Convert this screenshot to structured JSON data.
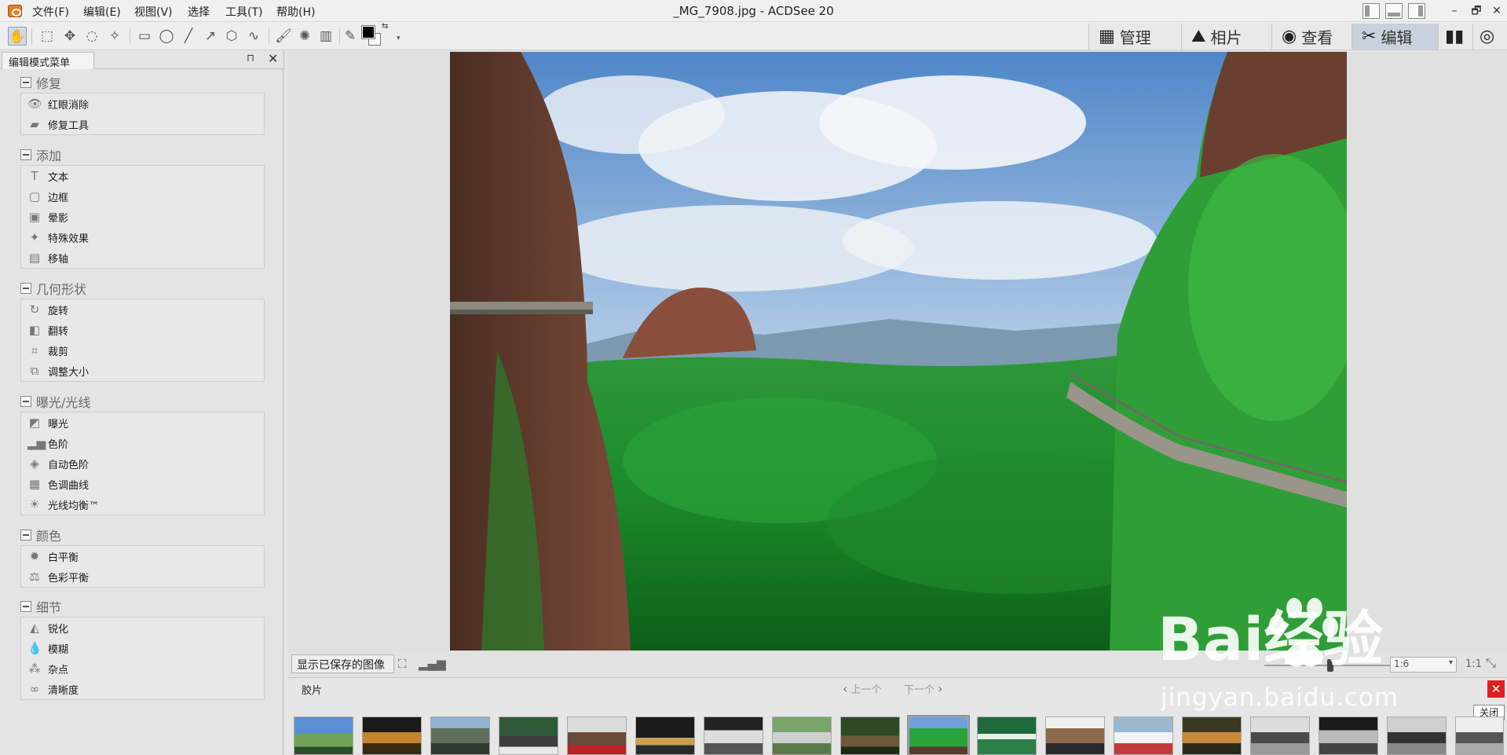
{
  "window": {
    "title": "_MG_7908.jpg - ACDSee 20",
    "minimize": "–",
    "restore": "🗗",
    "close": "✕"
  },
  "menu": [
    "文件(F)",
    "编辑(E)",
    "视图(V)",
    "选择",
    "工具(T)",
    "帮助(H)"
  ],
  "modes": [
    {
      "label": "管理",
      "icon": "grid-icon"
    },
    {
      "label": "相片",
      "icon": "photo-icon"
    },
    {
      "label": "查看",
      "icon": "eye-icon"
    },
    {
      "label": "编辑",
      "icon": "edit-icon",
      "active": true
    },
    {
      "label": "",
      "icon": "dashboard-icon"
    },
    {
      "label": "",
      "icon": "develop-eye-icon"
    }
  ],
  "panel": {
    "tab": "编辑模式菜单",
    "pin": "⊓",
    "close": "✕",
    "groups": [
      {
        "title": "修复",
        "items": [
          {
            "label": "红眼消除",
            "icon": "eye-redeye-icon"
          },
          {
            "label": "修复工具",
            "icon": "bandage-icon"
          }
        ]
      },
      {
        "title": "添加",
        "items": [
          {
            "label": "文本",
            "icon": "text-icon"
          },
          {
            "label": "边框",
            "icon": "border-icon"
          },
          {
            "label": "晕影",
            "icon": "vignette-icon"
          },
          {
            "label": "特殊效果",
            "icon": "effects-icon"
          },
          {
            "label": "移轴",
            "icon": "tilt-shift-icon"
          }
        ]
      },
      {
        "title": "几何形状",
        "items": [
          {
            "label": "旋转",
            "icon": "rotate-icon"
          },
          {
            "label": "翻转",
            "icon": "flip-icon"
          },
          {
            "label": "裁剪",
            "icon": "crop-icon"
          },
          {
            "label": "调整大小",
            "icon": "resize-icon"
          }
        ]
      },
      {
        "title": "曝光/光线",
        "items": [
          {
            "label": "曝光",
            "icon": "exposure-icon"
          },
          {
            "label": "色阶",
            "icon": "levels-icon"
          },
          {
            "label": "自动色阶",
            "icon": "auto-levels-icon"
          },
          {
            "label": "色调曲线",
            "icon": "tone-curve-icon"
          },
          {
            "label": "光线均衡™",
            "icon": "lighting-icon"
          }
        ]
      },
      {
        "title": "颜色",
        "items": [
          {
            "label": "白平衡",
            "icon": "white-balance-icon"
          },
          {
            "label": "色彩平衡",
            "icon": "color-balance-icon"
          }
        ]
      },
      {
        "title": "细节",
        "items": [
          {
            "label": "锐化",
            "icon": "sharpen-icon"
          },
          {
            "label": "模糊",
            "icon": "blur-icon"
          },
          {
            "label": "杂点",
            "icon": "noise-icon"
          },
          {
            "label": "清晰度",
            "icon": "clarity-icon"
          }
        ]
      }
    ]
  },
  "viewer": {
    "show_saved": "显示已保存的图像",
    "zoom_value": "1:6",
    "zoom_one": "1:1"
  },
  "filmstrip": {
    "title": "胶片",
    "prev": "上一个",
    "next": "下一个",
    "close_tip": "关闭",
    "selected_index": 9,
    "count": 18
  },
  "watermark": {
    "brand": "Bai经验",
    "url": "jingyan.baidu.com"
  },
  "colors": {
    "foreground": "#000000",
    "background": "#ffffff",
    "active_mode": "#c9d1dd"
  }
}
